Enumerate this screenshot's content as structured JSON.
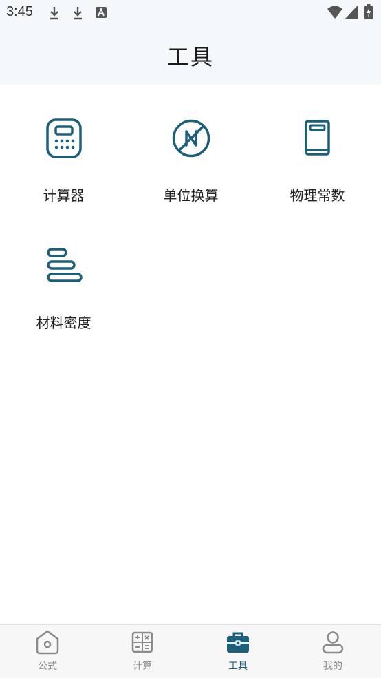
{
  "status_bar": {
    "time": "3:45"
  },
  "header": {
    "title": "工具"
  },
  "tools": [
    {
      "label": "计算器",
      "icon": "calculator-icon"
    },
    {
      "label": "单位换算",
      "icon": "unit-conversion-icon"
    },
    {
      "label": "物理常数",
      "icon": "book-icon"
    },
    {
      "label": "材料密度",
      "icon": "layers-icon"
    }
  ],
  "tabbar": {
    "items": [
      {
        "label": "公式",
        "icon": "formula-icon",
        "active": false
      },
      {
        "label": "计算",
        "icon": "calc-icon",
        "active": false
      },
      {
        "label": "工具",
        "icon": "toolbox-icon",
        "active": true
      },
      {
        "label": "我的",
        "icon": "profile-icon",
        "active": false
      }
    ]
  },
  "colors": {
    "accent": "#1b5f7a",
    "inactive": "#8a8a8a",
    "header_bg": "#f5f8fb"
  }
}
